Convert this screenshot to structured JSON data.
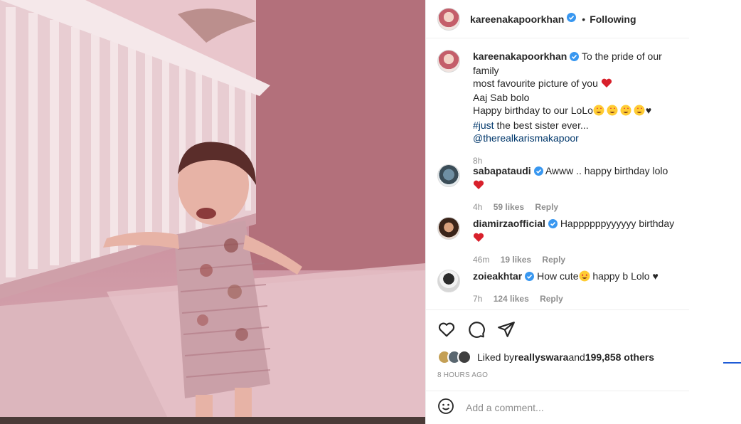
{
  "post": {
    "author": "kareenakapoorkhan",
    "following_label": "Following",
    "dot": "•"
  },
  "caption": {
    "username": "kareenakapoorkhan",
    "line1": "To the pride of our family",
    "line2": "most favourite picture of you",
    "line3": "Aaj Sab bolo",
    "line4": "Happy birthday to our LoLo",
    "hashtag": "#just",
    "line5_rest": " the best sister ever...",
    "mention": "@therealkarismakapoor",
    "time": "8h"
  },
  "comments": [
    {
      "username": "sabapataudi",
      "text": "Awww .. happy birthday lolo",
      "time": "4h",
      "likes": "59 likes",
      "reply": "Reply"
    },
    {
      "username": "diamirzaofficial",
      "text": "Happppppyyyyyy birthday",
      "time": "46m",
      "likes": "19 likes",
      "reply": "Reply"
    },
    {
      "username": "zoieakhtar",
      "text_a": "How cute",
      "text_b": " happy b Lolo ♥",
      "time": "7h",
      "likes": "124 likes",
      "reply": "Reply"
    }
  ],
  "likes": {
    "prefix": "Liked by ",
    "user": "reallyswara",
    "middle": " and ",
    "count": "199,858 others"
  },
  "timestamp": "8 HOURS AGO",
  "add_comment": {
    "placeholder": "Add a comment..."
  },
  "icons": {
    "like": "heart-outline-icon",
    "comment": "comment-bubble-icon",
    "share": "paper-plane-icon",
    "emoji": "smiley-icon",
    "verified": "verified-badge-icon"
  },
  "colors": {
    "verified": "#3897f0",
    "link": "#00376b",
    "heart": "#d8202b"
  }
}
